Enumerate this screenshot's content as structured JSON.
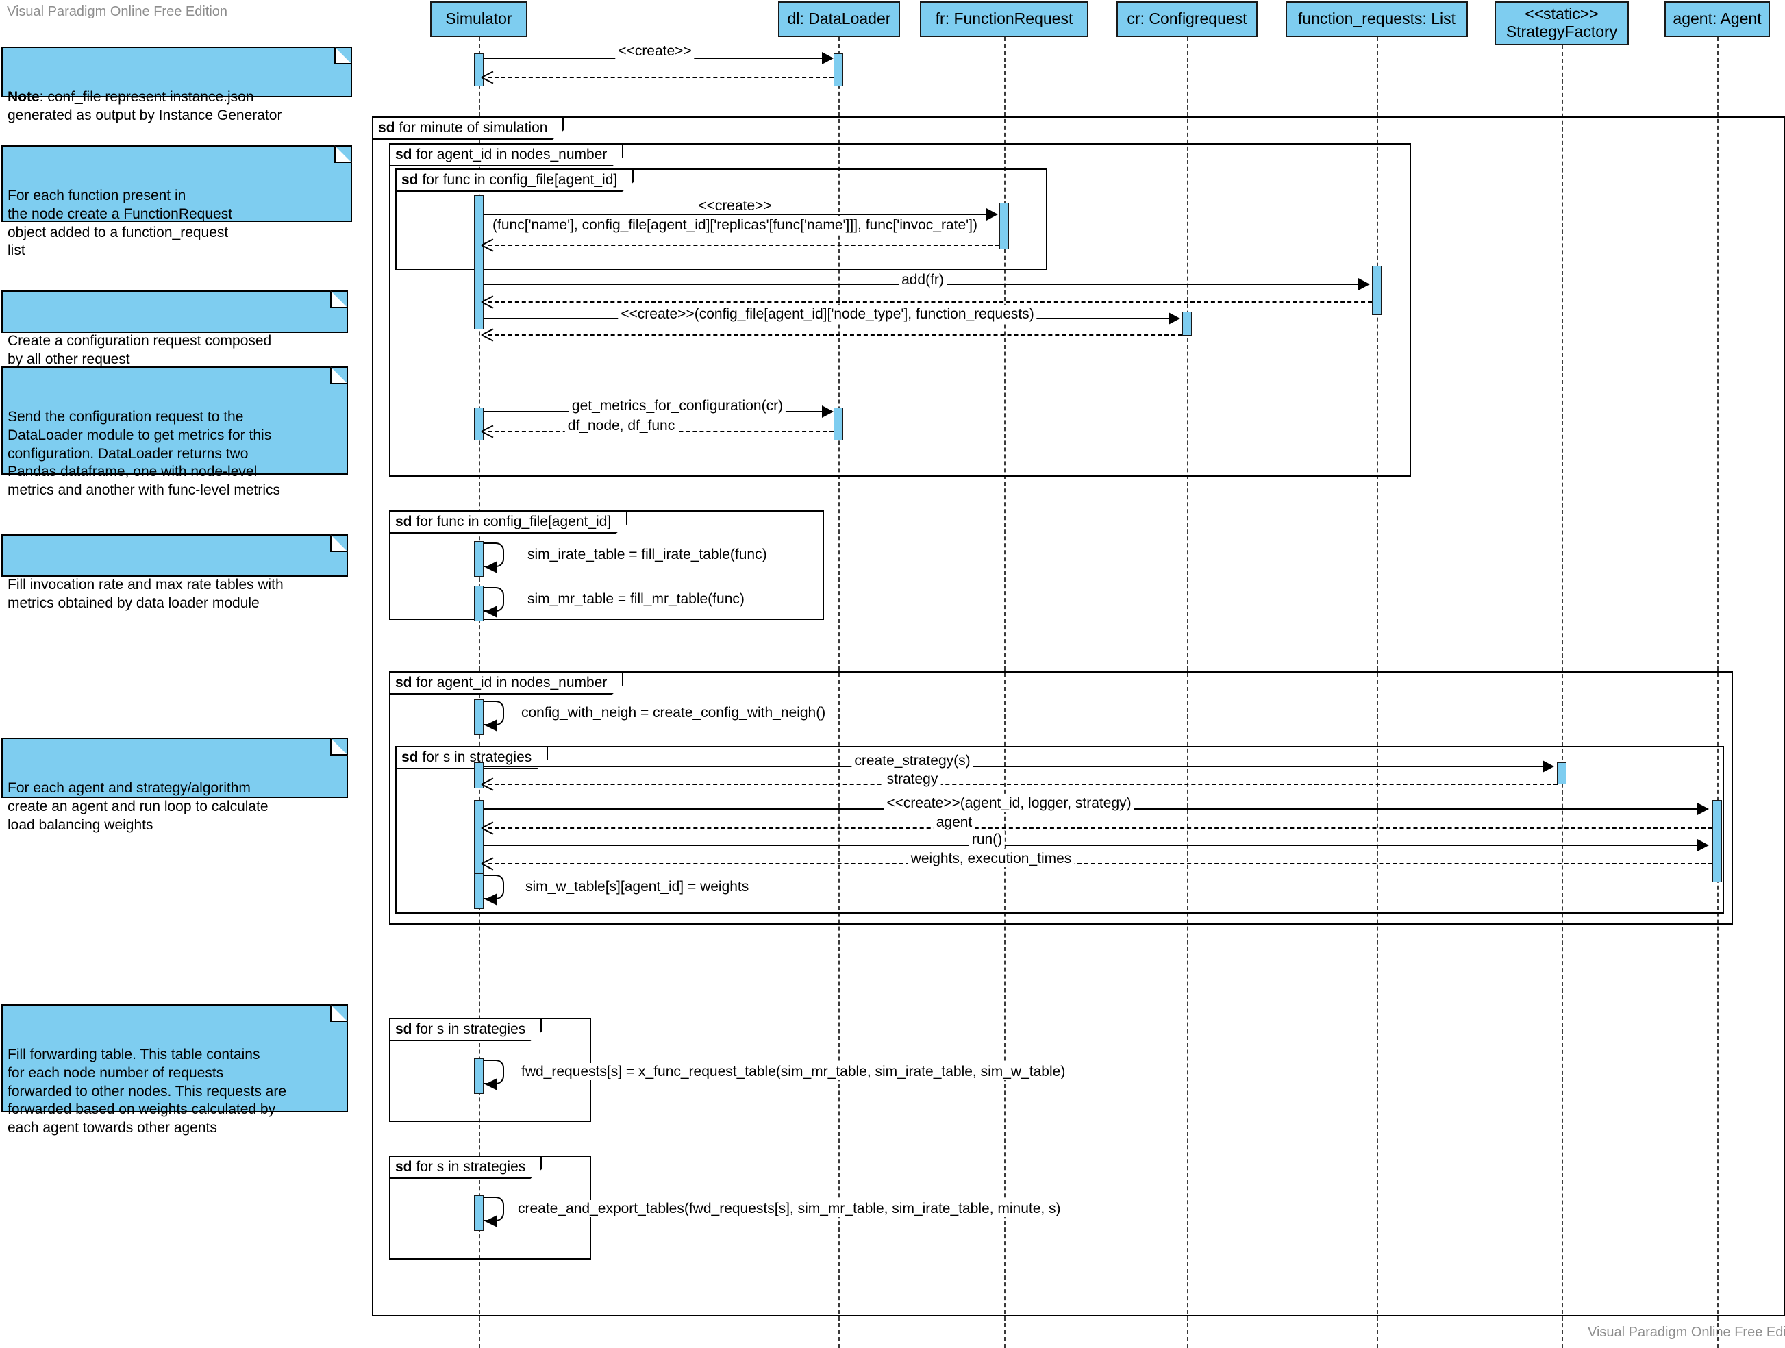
{
  "meta": {
    "watermark_top": "Visual Paradigm Online Free Edition",
    "watermark_bottom": "Visual Paradigm Online Free Edition"
  },
  "lifelines": [
    {
      "id": "simulator",
      "label": "Simulator"
    },
    {
      "id": "dataloader",
      "label": "dl: DataLoader"
    },
    {
      "id": "functionrequest",
      "label": "fr: FunctionRequest"
    },
    {
      "id": "configrequest",
      "label": "cr: Configrequest"
    },
    {
      "id": "function_requests",
      "label": "function_requests: List"
    },
    {
      "id": "strategyfactory",
      "label": "<<static>>\nStrategyFactory"
    },
    {
      "id": "agent",
      "label": "agent: Agent"
    }
  ],
  "notes": [
    {
      "id": "note-conf-file",
      "prefix": "Note",
      "text": ": conf_file represent instance.json\ngenerated as output by Instance Generator"
    },
    {
      "id": "note-function-request",
      "text": "For each function present in\nthe node create a FunctionRequest\nobject added to a function_request\nlist"
    },
    {
      "id": "note-config-request",
      "text": "Create a configuration request composed\nby all other request"
    },
    {
      "id": "note-dataloader",
      "text": "Send the configuration request to the\nDataLoader module to get metrics for this\nconfiguration. DataLoader returns two\nPandas dataframe, one with node-level\nmetrics and another with func-level metrics"
    },
    {
      "id": "note-fill-tables",
      "text": "Fill invocation rate and max rate tables with\nmetrics obtained by data loader module"
    },
    {
      "id": "note-agent-strategy",
      "text": "For each agent and strategy/algorithm\ncreate an agent and run loop to calculate\nload balancing weights"
    },
    {
      "id": "note-forwarding",
      "text": "Fill forwarding table. This table contains\nfor each node number of requests\nforwarded to other nodes. This requests are\nforwarded based on weights calculated by\neach agent towards other agents"
    }
  ],
  "fragments": [
    {
      "id": "frag-minute",
      "keyword": "sd",
      "label": "for minute of simulation"
    },
    {
      "id": "frag-agent-loop-1",
      "keyword": "sd",
      "label": "for agent_id in nodes_number"
    },
    {
      "id": "frag-func-loop-1",
      "keyword": "sd",
      "label": "for func in config_file[agent_id]"
    },
    {
      "id": "frag-func-loop-2",
      "keyword": "sd",
      "label": "for func in config_file[agent_id]"
    },
    {
      "id": "frag-agent-loop-2",
      "keyword": "sd",
      "label": "for agent_id in nodes_number"
    },
    {
      "id": "frag-strategies-1",
      "keyword": "sd",
      "label": "for s in strategies"
    },
    {
      "id": "frag-strategies-2",
      "keyword": "sd",
      "label": "for s in strategies"
    },
    {
      "id": "frag-strategies-3",
      "keyword": "sd",
      "label": "for s in strategies"
    }
  ],
  "messages": [
    {
      "id": "msg-create-dataloader",
      "label": "<<create>>"
    },
    {
      "id": "msg-return-dataloader",
      "label": ""
    },
    {
      "id": "msg-create-funcrequest-1",
      "label": "<<create>>"
    },
    {
      "id": "msg-create-funcrequest-2",
      "label": "(func['name'], config_file[agent_id]['replicas'[func['name']]], func['invoc_rate'])"
    },
    {
      "id": "msg-return-funcrequest",
      "label": ""
    },
    {
      "id": "msg-add-fr",
      "label": "add(fr)"
    },
    {
      "id": "msg-return-add-fr",
      "label": ""
    },
    {
      "id": "msg-create-configrequest",
      "label": "<<create>>(config_file[agent_id]['node_type'], function_requests)"
    },
    {
      "id": "msg-return-configrequest",
      "label": ""
    },
    {
      "id": "msg-get-metrics",
      "label": "get_metrics_for_configuration(cr)"
    },
    {
      "id": "msg-return-metrics",
      "label": "df_node, df_func"
    },
    {
      "id": "msg-fill-irate",
      "label": "sim_irate_table = fill_irate_table(func)"
    },
    {
      "id": "msg-fill-mr",
      "label": "sim_mr_table = fill_mr_table(func)"
    },
    {
      "id": "msg-config-with-neigh",
      "label": "config_with_neigh = create_config_with_neigh()"
    },
    {
      "id": "msg-create-strategy",
      "label": "create_strategy(s)"
    },
    {
      "id": "msg-return-strategy",
      "label": "strategy"
    },
    {
      "id": "msg-create-agent",
      "label": "<<create>>(agent_id, logger, strategy)"
    },
    {
      "id": "msg-return-agent",
      "label": "agent"
    },
    {
      "id": "msg-run",
      "label": "run()"
    },
    {
      "id": "msg-return-run",
      "label": "weights, execution_times"
    },
    {
      "id": "msg-sim-w-table",
      "label": "sim_w_table[s][agent_id] = weights"
    },
    {
      "id": "msg-fwd-requests",
      "label": "fwd_requests[s] = x_func_request_table(sim_mr_table, sim_irate_table, sim_w_table)"
    },
    {
      "id": "msg-create-export",
      "label": "create_and_export_tables(fwd_requests[s], sim_mr_table, sim_irate_table, minute, s)"
    }
  ],
  "colors": {
    "fill": "#7ecdf0",
    "stroke": "#1a1a1a",
    "watermark": "#8d8d8d"
  }
}
